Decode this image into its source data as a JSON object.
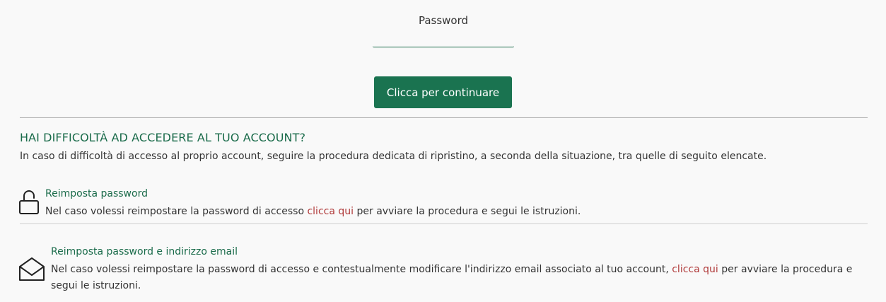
{
  "login": {
    "password_label": "Password",
    "password_value": "",
    "continue_button": "Clicca per continuare"
  },
  "help": {
    "title": "HAI DIFFICOLTÀ AD ACCEDERE AL TUO ACCOUNT?",
    "description": "In caso di difficoltà di accesso al proprio account, seguire la procedura dedicata di ripristino, a seconda della situazione, tra quelle di seguito elencate."
  },
  "options": [
    {
      "icon": "lock-icon",
      "title": "Reimposta password",
      "text_before": "Nel caso volessi reimpostare la password di accesso ",
      "link": "clicca qui",
      "text_after": " per avviare la procedura e segui le istruzioni."
    },
    {
      "icon": "envelope-icon",
      "title": "Reimposta password e indirizzo email",
      "text_before": "Nel caso volessi reimpostare la password di accesso e contestualmente modificare l'indirizzo email associato al tuo account, ",
      "link": "clicca qui",
      "text_after": " per avviare la procedura e segui le istruzioni."
    }
  ],
  "colors": {
    "accent_green": "#1a7350",
    "title_green": "#1a6b4a",
    "link_red": "#b03a3a",
    "background": "#f9f9f9"
  }
}
